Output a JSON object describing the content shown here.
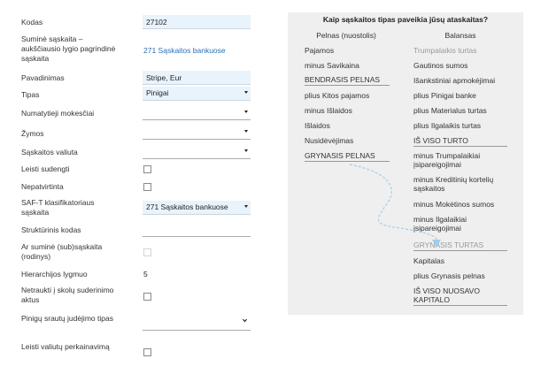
{
  "form": {
    "kodas": {
      "label": "Kodas",
      "value": "27102"
    },
    "sumine": {
      "label": "Suminė sąskaita – aukščiausio lygio pagrindinė sąskaita",
      "value": "271 Sąskaitos bankuose"
    },
    "pavadinimas": {
      "label": "Pavadinimas",
      "value": "Stripe, Eur"
    },
    "tipas": {
      "label": "Tipas",
      "value": "Pinigai"
    },
    "mokesciai": {
      "label": "Numatytieji mokesčiai",
      "value": ""
    },
    "zymos": {
      "label": "Žymos",
      "value": ""
    },
    "valiuta": {
      "label": "Sąskaitos valiuta",
      "value": ""
    },
    "sudengti": {
      "label": "Leisti sudengti",
      "checked": false
    },
    "nepatvirtinta": {
      "label": "Nepatvirtinta",
      "checked": false
    },
    "saft": {
      "label": "SAF-T klasifikatoriaus sąskaita",
      "value": "271 Sąskaitos bankuose"
    },
    "strukturinis": {
      "label": "Struktūrinis kodas",
      "value": ""
    },
    "sumine_sub": {
      "label": "Ar suminė (sub)sąskaita (rodinys)",
      "checked": false,
      "disabled": true
    },
    "hierarchija": {
      "label": "Hierarchijos lygmuo",
      "value": "5"
    },
    "netraukti": {
      "label": "Netraukti į skolų suderinimo aktus",
      "checked": false
    },
    "srautu": {
      "label": "Pinigų srautų judėjimo tipas",
      "value": ""
    },
    "perkainavima": {
      "label": "Leisti valiutų perkainavimą",
      "checked": false
    }
  },
  "help": {
    "title": "Kaip sąskaitos tipas paveikia jūsų ataskaitas?",
    "pl_head": "Pelnas (nuostolis)",
    "bs_head": "Balansas",
    "pl_items": [
      "Pajamos",
      "minus Savikaina",
      "BENDRASIS PELNAS",
      "plius Kitos pajamos",
      "minus Išlaidos",
      "Išlaidos",
      "Nusidėvėjimas",
      "GRYNASIS PELNAS"
    ],
    "bs_items": [
      "Trumpalaikis turtas",
      "Gautinos sumos",
      "Išankstiniai apmokėjimai",
      "plius Pinigai banke",
      "plius Materialus turtas",
      "plius Ilgalaikis turtas",
      "IŠ VISO TURTO",
      "minus Trumpalaikiai įsipareigojimai",
      "minus Kreditinių kortelių sąskaitos",
      "minus Mokėtinos sumos",
      "minus Ilgalaikiai įsipareigojimai",
      "GRYNASIS TURTAS",
      "Kapitalas",
      "plius Grynasis pelnas",
      "IŠ VISO NUOSAVO KAPITALO"
    ]
  },
  "colors": {
    "input_bg": "#e9f3fc",
    "link": "#2a6fb2",
    "panel_bg": "#efefef",
    "flow_line": "#9ecfe6"
  },
  "icons": [
    "caret-down-icon",
    "chevron-down-icon",
    "dashed-flow-arrow"
  ]
}
